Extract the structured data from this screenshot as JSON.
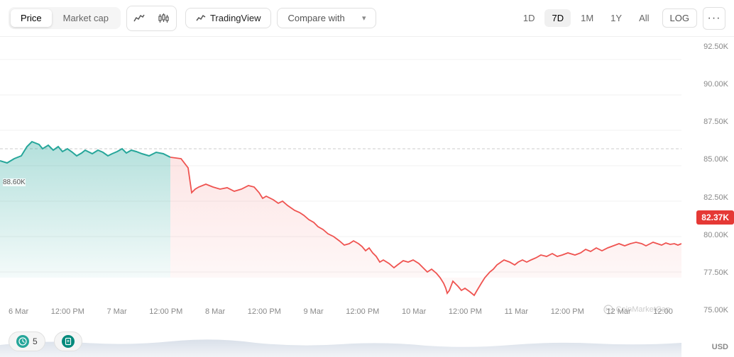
{
  "toolbar": {
    "tabs": [
      {
        "id": "price",
        "label": "Price",
        "active": true
      },
      {
        "id": "market-cap",
        "label": "Market cap",
        "active": false
      }
    ],
    "icons": [
      {
        "id": "line-chart",
        "symbol": "∿"
      },
      {
        "id": "candle-chart",
        "symbol": "⊕"
      }
    ],
    "trading_view_label": "TradingView",
    "compare_label": "Compare with",
    "time_buttons": [
      {
        "id": "1d",
        "label": "1D",
        "active": false
      },
      {
        "id": "7d",
        "label": "7D",
        "active": true
      },
      {
        "id": "1m",
        "label": "1M",
        "active": false
      },
      {
        "id": "1y",
        "label": "1Y",
        "active": false
      },
      {
        "id": "all",
        "label": "All",
        "active": false
      }
    ],
    "log_label": "LOG",
    "more_label": "···"
  },
  "chart": {
    "current_price": "82.37K",
    "start_price_label": "88.60K",
    "watermark": "CoinMarketCap",
    "usd_label": "USD",
    "y_labels": [
      "92.50K",
      "90.00K",
      "87.50K",
      "85.00K",
      "82.50K",
      "80.00K",
      "77.50K",
      "75.00K"
    ],
    "x_labels": [
      "6 Mar",
      "12:00 PM",
      "7 Mar",
      "12:00 PM",
      "8 Mar",
      "12:00 PM",
      "9 Mar",
      "12:00 PM",
      "10 Mar",
      "12:00 PM",
      "11 Mar",
      "12:00 PM",
      "12 Mar",
      "12:00"
    ]
  },
  "badges": [
    {
      "id": "badge-clock",
      "icon": "⏱",
      "count": "5"
    },
    {
      "id": "badge-doc",
      "icon": "📄",
      "count": ""
    }
  ]
}
